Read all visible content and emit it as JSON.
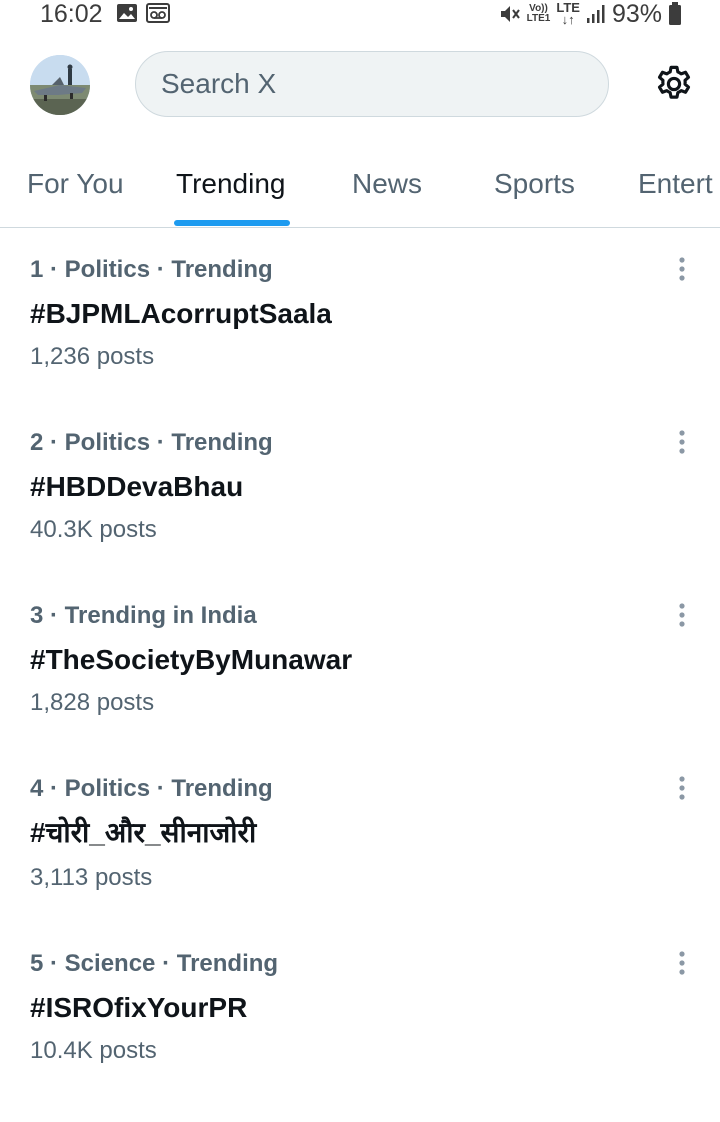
{
  "status_bar": {
    "time": "16:02",
    "volte_top": "Vo))",
    "volte_bottom": "LTE1",
    "lte_top": "LTE",
    "lte_bottom": "↓↑",
    "battery": "93%"
  },
  "header": {
    "search_placeholder": "Search X",
    "settings_icon": "gear-icon",
    "avatar": "profile-avatar"
  },
  "tabs": [
    {
      "label": "For You",
      "active": false
    },
    {
      "label": "Trending",
      "active": true
    },
    {
      "label": "News",
      "active": false
    },
    {
      "label": "Sports",
      "active": false
    },
    {
      "label": "Entert",
      "active": false
    }
  ],
  "trends": [
    {
      "meta": "1 · Politics · Trending",
      "title": "#BJPMLAcorruptSaala",
      "count": "1,236 posts"
    },
    {
      "meta": "2 · Politics · Trending",
      "title": "#HBDDevaBhau",
      "count": "40.3K posts"
    },
    {
      "meta": "3 · Trending in India",
      "title": "#TheSocietyByMunawar",
      "count": "1,828 posts"
    },
    {
      "meta": "4 · Politics · Trending",
      "title": "#चोरी_और_सीनाजोरी",
      "count": "3,113 posts"
    },
    {
      "meta": "5 · Science · Trending",
      "title": "#ISROfixYourPR",
      "count": "10.4K posts"
    }
  ],
  "colors": {
    "accent": "#1d9bf0",
    "primary_text": "#0f1419",
    "secondary_text": "#536471",
    "divider": "#cfd9de",
    "search_bg": "#eff3f4"
  }
}
